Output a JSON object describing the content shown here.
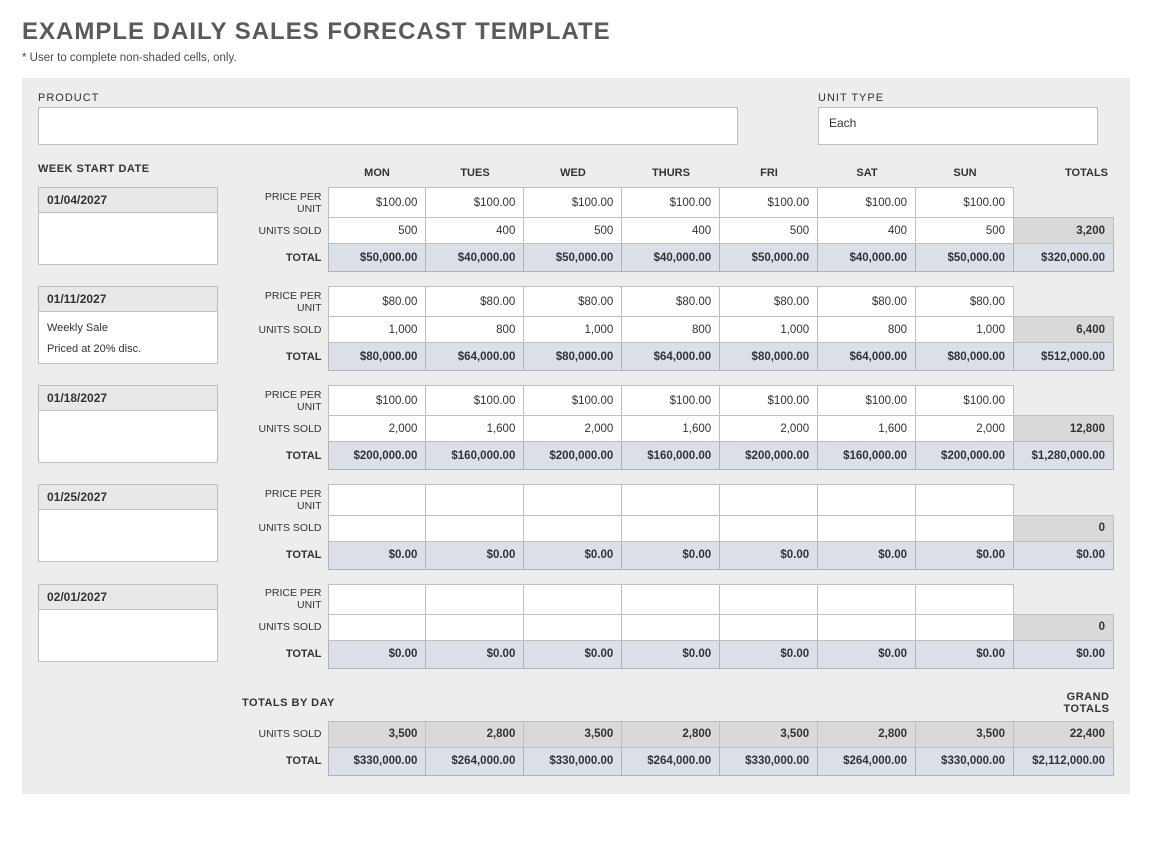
{
  "title": "EXAMPLE DAILY SALES FORECAST TEMPLATE",
  "note": "* User to complete non-shaded cells, only.",
  "labels": {
    "product": "PRODUCT",
    "unitType": "UNIT TYPE",
    "weekStart": "WEEK START DATE",
    "pricePerUnit": "PRICE PER UNIT",
    "unitsSold": "UNITS SOLD",
    "total": "TOTAL",
    "totalsByDay": "TOTALS BY DAY",
    "grandTotals": "GRAND TOTALS",
    "totals": "TOTALS"
  },
  "product": "",
  "unitType": "Each",
  "days": [
    "MON",
    "TUES",
    "WED",
    "THURS",
    "FRI",
    "SAT",
    "SUN"
  ],
  "weeks": [
    {
      "date": "01/04/2027",
      "notes": [],
      "price": [
        "$100.00",
        "$100.00",
        "$100.00",
        "$100.00",
        "$100.00",
        "$100.00",
        "$100.00"
      ],
      "units": [
        "500",
        "400",
        "500",
        "400",
        "500",
        "400",
        "500"
      ],
      "unitsTotal": "3,200",
      "dayTotals": [
        "$50,000.00",
        "$40,000.00",
        "$50,000.00",
        "$40,000.00",
        "$50,000.00",
        "$40,000.00",
        "$50,000.00"
      ],
      "weekTotal": "$320,000.00"
    },
    {
      "date": "01/11/2027",
      "notes": [
        "Weekly Sale",
        "Priced at 20% disc."
      ],
      "price": [
        "$80.00",
        "$80.00",
        "$80.00",
        "$80.00",
        "$80.00",
        "$80.00",
        "$80.00"
      ],
      "units": [
        "1,000",
        "800",
        "1,000",
        "800",
        "1,000",
        "800",
        "1,000"
      ],
      "unitsTotal": "6,400",
      "dayTotals": [
        "$80,000.00",
        "$64,000.00",
        "$80,000.00",
        "$64,000.00",
        "$80,000.00",
        "$64,000.00",
        "$80,000.00"
      ],
      "weekTotal": "$512,000.00"
    },
    {
      "date": "01/18/2027",
      "notes": [],
      "price": [
        "$100.00",
        "$100.00",
        "$100.00",
        "$100.00",
        "$100.00",
        "$100.00",
        "$100.00"
      ],
      "units": [
        "2,000",
        "1,600",
        "2,000",
        "1,600",
        "2,000",
        "1,600",
        "2,000"
      ],
      "unitsTotal": "12,800",
      "dayTotals": [
        "$200,000.00",
        "$160,000.00",
        "$200,000.00",
        "$160,000.00",
        "$200,000.00",
        "$160,000.00",
        "$200,000.00"
      ],
      "weekTotal": "$1,280,000.00"
    },
    {
      "date": "01/25/2027",
      "notes": [],
      "price": [
        "",
        "",
        "",
        "",
        "",
        "",
        ""
      ],
      "units": [
        "",
        "",
        "",
        "",
        "",
        "",
        ""
      ],
      "unitsTotal": "0",
      "dayTotals": [
        "$0.00",
        "$0.00",
        "$0.00",
        "$0.00",
        "$0.00",
        "$0.00",
        "$0.00"
      ],
      "weekTotal": "$0.00"
    },
    {
      "date": "02/01/2027",
      "notes": [],
      "price": [
        "",
        "",
        "",
        "",
        "",
        "",
        ""
      ],
      "units": [
        "",
        "",
        "",
        "",
        "",
        "",
        ""
      ],
      "unitsTotal": "0",
      "dayTotals": [
        "$0.00",
        "$0.00",
        "$0.00",
        "$0.00",
        "$0.00",
        "$0.00",
        "$0.00"
      ],
      "weekTotal": "$0.00"
    }
  ],
  "summary": {
    "units": [
      "3,500",
      "2,800",
      "3,500",
      "2,800",
      "3,500",
      "2,800",
      "3,500"
    ],
    "unitsGrand": "22,400",
    "totals": [
      "$330,000.00",
      "$264,000.00",
      "$330,000.00",
      "$264,000.00",
      "$330,000.00",
      "$264,000.00",
      "$330,000.00"
    ],
    "grandTotal": "$2,112,000.00"
  }
}
